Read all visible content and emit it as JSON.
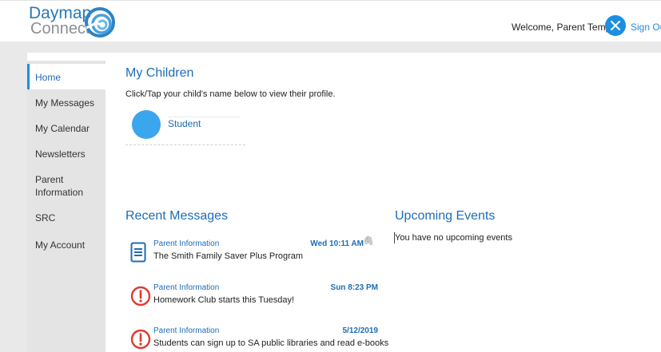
{
  "header": {
    "logo_line1": "Daymap",
    "logo_line2": "Connect",
    "logo_icon": "daymap-swirl-icon",
    "welcome": "Welcome, Parent Temp",
    "signout_label": "Sign Out",
    "signout_icon": "close-icon",
    "accent": "#1e8ee0"
  },
  "sidebar": {
    "items": [
      {
        "label": "Home",
        "active": true
      },
      {
        "label": "My Messages"
      },
      {
        "label": "My Calendar"
      },
      {
        "label": "Newsletters"
      },
      {
        "label": "Parent Information"
      },
      {
        "label": "SRC"
      },
      {
        "label": "My Account"
      }
    ]
  },
  "children": {
    "title": "My Children",
    "helper": "Click/Tap your child's name below to view their profile.",
    "list": [
      {
        "name": "Student"
      }
    ]
  },
  "messages": {
    "title": "Recent Messages",
    "items": [
      {
        "icon": "document-icon",
        "category": "Parent Information",
        "date": "Wed 10:11 AM",
        "subject": "The Smith Family Saver Plus Program",
        "attachment": true
      },
      {
        "icon": "alert-icon",
        "category": "Parent Information",
        "date": "Sun 8:23 PM",
        "subject": "Homework Club starts this Tuesday!"
      },
      {
        "icon": "alert-icon",
        "category": "Parent Information",
        "date": "5/12/2019",
        "subject": "Students can sign up to SA public libraries and read e-books"
      }
    ]
  },
  "events": {
    "title": "Upcoming Events",
    "empty_text": "You have no upcoming events"
  }
}
